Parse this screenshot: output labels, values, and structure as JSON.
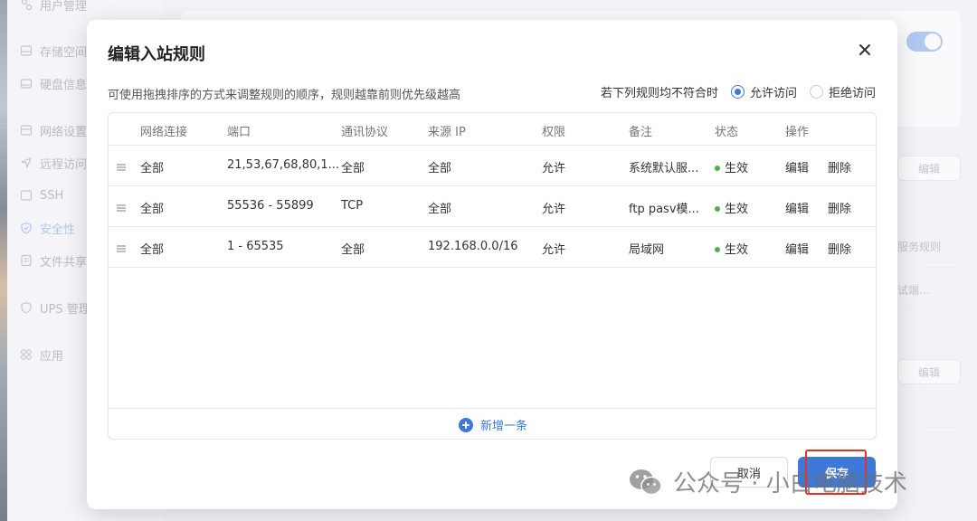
{
  "background": {
    "sidebar": [
      {
        "label": "用户管理",
        "icon": "users-icon"
      },
      {
        "label": "存储空间",
        "icon": "storage-icon"
      },
      {
        "label": "硬盘信息",
        "icon": "disk-icon"
      },
      {
        "label": "网络设置",
        "icon": "network-icon"
      },
      {
        "label": "远程访问",
        "icon": "send-icon"
      },
      {
        "label": "SSH",
        "icon": "ssh-icon"
      },
      {
        "label": "安全性",
        "icon": "shield-icon",
        "active": true
      },
      {
        "label": "文件共享",
        "icon": "file-share-icon"
      },
      {
        "label": "UPS 管理",
        "icon": "ups-icon"
      },
      {
        "label": "应用",
        "icon": "apps-icon"
      }
    ],
    "edit_label_1": "编辑",
    "edit_label_2": "编辑",
    "side_text_1": "服务规则",
    "side_text_2": "试端..."
  },
  "modal": {
    "title": "编辑入站规则",
    "description": "可使用拖拽排序的方式来调整规则的顺序，规则越靠前则优先级越高",
    "policy_label": "若下列规则均不符合时",
    "policy_options": [
      {
        "label": "允许访问",
        "selected": true
      },
      {
        "label": "拒绝访问",
        "selected": false
      }
    ],
    "columns": [
      "网络连接",
      "端口",
      "通讯协议",
      "来源 IP",
      "权限",
      "备注",
      "状态",
      "操作"
    ],
    "rows": [
      {
        "network": "全部",
        "port": "21,53,67,68,80,1...",
        "protocol": "全部",
        "source": "全部",
        "permission": "允许",
        "note": "系统默认服...",
        "status": "生效",
        "edit": "编辑",
        "delete": "删除"
      },
      {
        "network": "全部",
        "port": "55536 - 55899",
        "protocol": "TCP",
        "source": "全部",
        "permission": "允许",
        "note": "ftp pasv模...",
        "status": "生效",
        "edit": "编辑",
        "delete": "删除"
      },
      {
        "network": "全部",
        "port": "1 - 65535",
        "protocol": "全部",
        "source": "192.168.0.0/16",
        "permission": "允许",
        "note": "局域网",
        "status": "生效",
        "edit": "编辑",
        "delete": "删除"
      }
    ],
    "add_label": "新增一条",
    "cancel_label": "取消",
    "save_label": "保存"
  },
  "watermark": {
    "text": "公众号 · 小白电脑技术"
  },
  "colors": {
    "accent": "#3e78d8",
    "status_active": "#4caf50",
    "highlight": "#e0322b"
  }
}
